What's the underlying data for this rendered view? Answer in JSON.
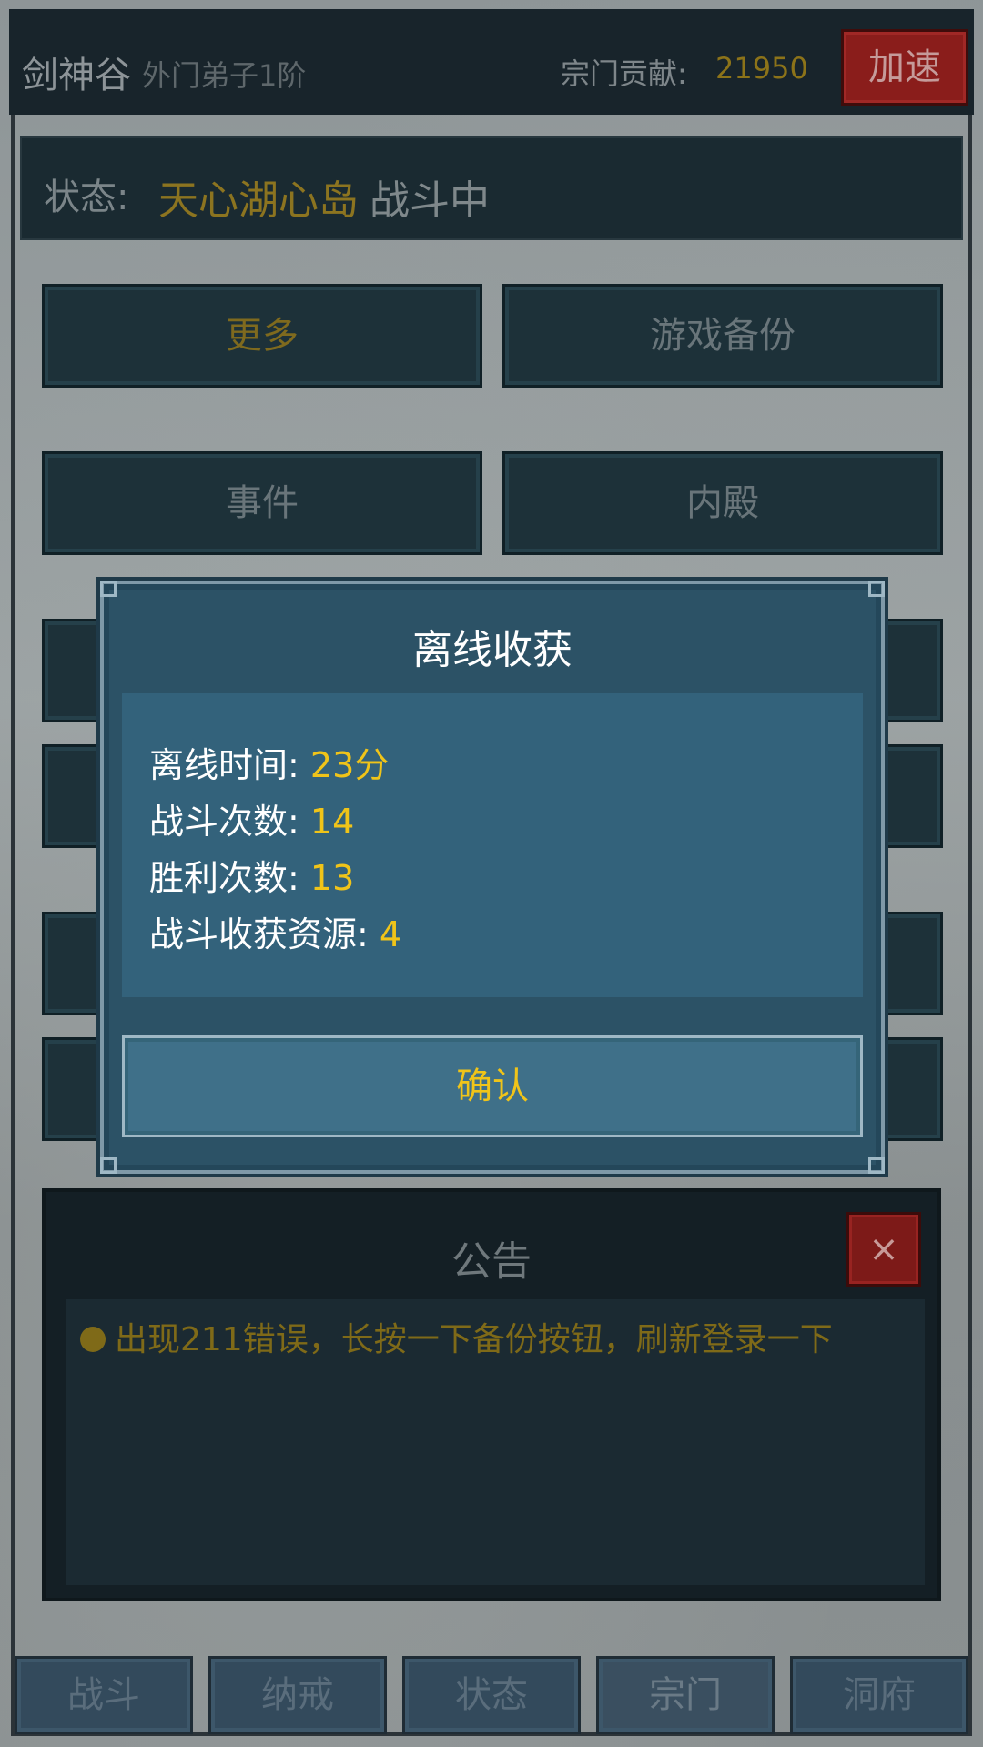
{
  "header": {
    "sect_name": "剑神谷",
    "rank": "外门弟子1阶",
    "contribution_label": "宗门贡献:",
    "contribution_value": "21950",
    "speed_button": "加速"
  },
  "status": {
    "label": "状态:",
    "place": "天心湖心岛",
    "state": "战斗中"
  },
  "menu": {
    "more": "更多",
    "backup": "游戏备份",
    "events": "事件",
    "inner_hall": "内殿"
  },
  "modal": {
    "title": "离线收获",
    "stats": [
      {
        "label": "离线时间:",
        "value": "23分"
      },
      {
        "label": "战斗次数:",
        "value": "14"
      },
      {
        "label": "胜利次数:",
        "value": "13"
      },
      {
        "label": "战斗收获资源:",
        "value": "4"
      }
    ],
    "confirm": "确认"
  },
  "notice": {
    "title": "公告",
    "close_icon": "×",
    "text": "出现211错误，长按一下备份按钮，刷新登录一下"
  },
  "tabs": [
    {
      "label": "战斗"
    },
    {
      "label": "纳戒"
    },
    {
      "label": "状态"
    },
    {
      "label": "宗门"
    },
    {
      "label": "洞府"
    }
  ],
  "colors": {
    "accent_gold": "#f0c419",
    "dim_gold": "#8c7420",
    "close_red": "#8a1d1b",
    "modal_blue": "#2c5266"
  }
}
